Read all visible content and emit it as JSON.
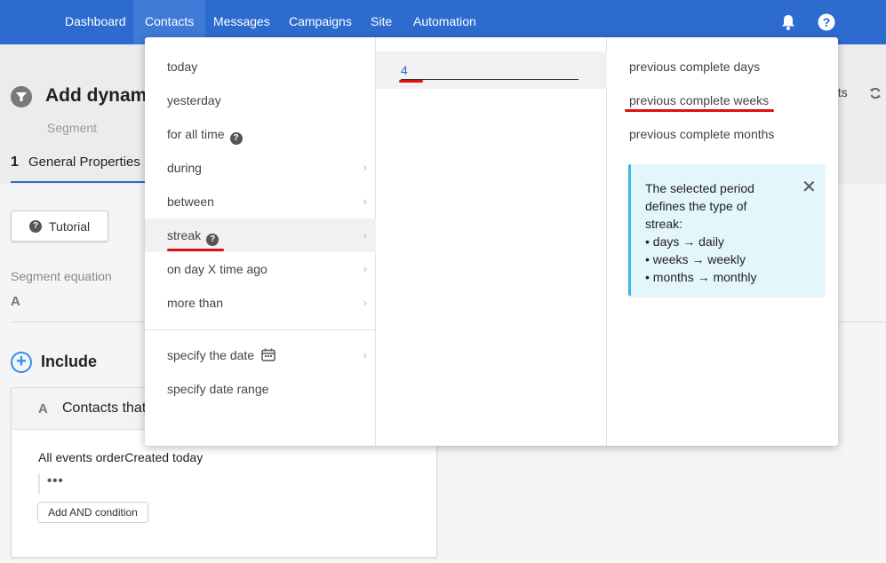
{
  "topnav": {
    "items": [
      "Dashboard",
      "Contacts",
      "Messages",
      "Campaigns",
      "Site",
      "Automation"
    ],
    "active": "Contacts",
    "bell_icon": "bell-icon",
    "help_icon": "help-icon"
  },
  "page": {
    "title": "Add dynami",
    "subtitle": "Segment",
    "contacts_label": "acts",
    "step_number": "1",
    "step_label": "General Properties",
    "tutorial_label": "Tutorial",
    "segment_equation_label": "Segment equation",
    "segment_equation_value": "A",
    "include_label": "Include",
    "card": {
      "letter": "A",
      "title": "Contacts that",
      "rule": "All events orderCreated  today",
      "dots": "•••",
      "add_and_label": "Add AND condition"
    }
  },
  "dropdown": {
    "col1": {
      "options": [
        "today",
        "yesterday",
        "for all time",
        "during",
        "between",
        "streak",
        "on day X time ago",
        "more than",
        "specify the date",
        "specify date range"
      ],
      "highlighted": "streak"
    },
    "col2": {
      "value": "4"
    },
    "col3": {
      "periods": [
        "previous complete days",
        "previous complete weeks",
        "previous complete months"
      ],
      "selected": "previous complete weeks",
      "info": {
        "lines": [
          "The selected period",
          "defines the type of",
          "streak:",
          "• days → daily",
          "• weeks → weekly",
          "• months → monthly"
        ],
        "close_icon": "close-icon"
      }
    }
  },
  "colors": {
    "nav_bg": "#2d6bcf",
    "annotation_red": "#e01010",
    "info_bg": "#e3f6fc",
    "info_border": "#42b6e5"
  }
}
